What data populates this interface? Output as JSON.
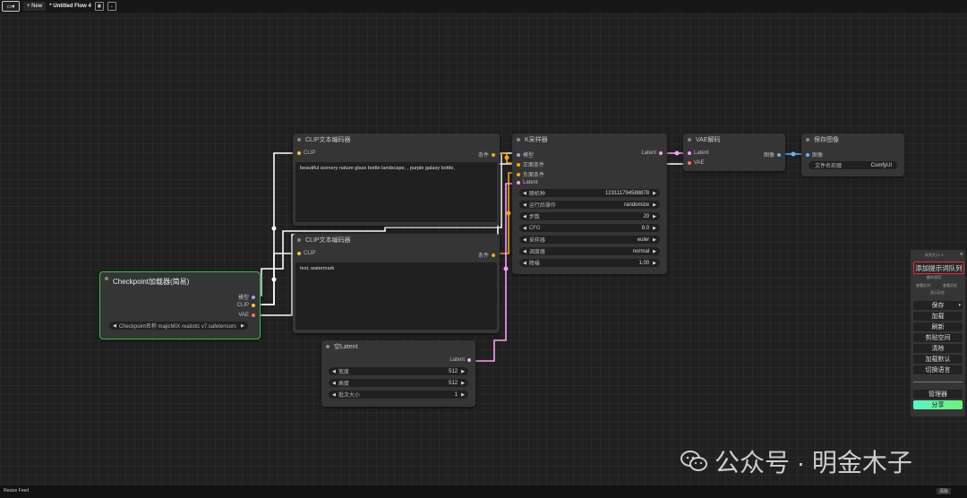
{
  "topbar": {
    "new_label": "+ New",
    "flow_title": "* Untitled Flow 4"
  },
  "nodes": {
    "clip_pos": {
      "title": "CLIP文本编码器",
      "in_clip": "CLIP",
      "out_cond": "条件",
      "text": "beautiful scenery nature glass bottle landscape, , purple galaxy bottle,"
    },
    "clip_neg": {
      "title": "CLIP文本编码器",
      "in_clip": "CLIP",
      "out_cond": "条件",
      "text": "text, watermark"
    },
    "checkpoint": {
      "title": "Checkpoint加载器(简易)",
      "out_model": "模型",
      "out_clip": "CLIP",
      "out_vae": "VAE",
      "ckpt_value": "Checkpoint名称 majicMIX realistic v7.safetensors"
    },
    "latent": {
      "title": "空Latent",
      "out_latent": "Latent",
      "widgets": [
        {
          "label": "宽度",
          "value": "512"
        },
        {
          "label": "高度",
          "value": "512"
        },
        {
          "label": "批次大小",
          "value": "1"
        }
      ]
    },
    "ksampler": {
      "title": "K采样器",
      "in_model": "模型",
      "in_pos": "正面条件",
      "in_neg": "负面条件",
      "in_latent": "Latent",
      "out_latent": "Latent",
      "widgets": [
        {
          "label": "随机种",
          "value": "123111794588878"
        },
        {
          "label": "运行后操作",
          "value": "randomize"
        },
        {
          "label": "步数",
          "value": "20"
        },
        {
          "label": "CFG",
          "value": "8.0"
        },
        {
          "label": "采样器",
          "value": "euler"
        },
        {
          "label": "调度器",
          "value": "normal"
        },
        {
          "label": "降噪",
          "value": "1.00"
        }
      ]
    },
    "vae_decode": {
      "title": "VAE解码",
      "in_latent": "Latent",
      "in_vae": "VAE",
      "out_image": "图像"
    },
    "save_image": {
      "title": "保存图像",
      "in_image": "图像",
      "prefix_label": "文件名前缀",
      "prefix_value": "ComfyUI"
    }
  },
  "panel": {
    "queue_size": "队列大小: 1",
    "queue_prompt": "添加提示词队列",
    "extra_options": "额外选项",
    "view_queue": "查看队列",
    "view_history": "查看历史",
    "show_history": "显示历史",
    "save": "保存",
    "load": "加载",
    "refresh": "刷新",
    "clipspace": "剪贴空间",
    "clear": "清除",
    "load_default": "加载默认",
    "switch_lang": "切换语言",
    "manager": "管理器",
    "share": "分享"
  },
  "watermark": {
    "text": "公众号 · 明金木子"
  },
  "bottombar": {
    "left_label": "Resize Feed",
    "right_label": "清除"
  },
  "colors": {
    "clip": "#f5c842",
    "cond": "#f5a623",
    "model": "#b39ddb",
    "latent": "#ff9cf9",
    "vae": "#ff6e6e",
    "image": "#64b5f6",
    "selected": "#3fbf3f",
    "share": "#5ef2a0",
    "queue_border": "#e03030"
  }
}
